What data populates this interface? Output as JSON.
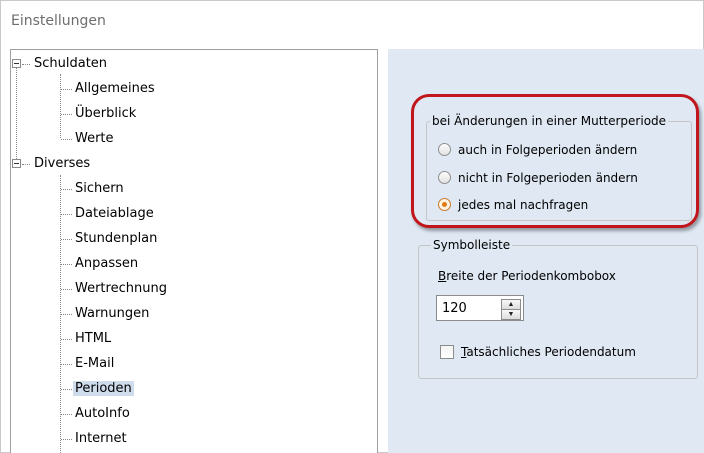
{
  "window": {
    "title": "Einstellungen"
  },
  "tree": {
    "groups": [
      {
        "label": "Schuldaten",
        "expander": "−",
        "items": [
          "Allgemeines",
          "Überblick",
          "Werte"
        ]
      },
      {
        "label": "Diverses",
        "expander": "−",
        "items": [
          "Sichern",
          "Dateiablage",
          "Stundenplan",
          "Anpassen",
          "Wertrechnung",
          "Warnungen",
          "HTML",
          "E-Mail",
          "Perioden",
          "AutoInfo",
          "Internet"
        ]
      }
    ],
    "selected": "Perioden"
  },
  "changes_group": {
    "caption": "bei Änderungen in einer Mutterperiode",
    "options": [
      {
        "label": "auch in Folgeperioden ändern",
        "checked": false
      },
      {
        "label": "nicht in Folgeperioden ändern",
        "checked": false
      },
      {
        "label": "jedes mal nachfragen",
        "checked": true
      }
    ]
  },
  "toolbar_group": {
    "caption": "Symbolleiste",
    "width_label": "Breite der Periodenkombobox",
    "width_label_accel": "B",
    "width_label_rest": "reite der Periodenkombobox",
    "width_value": "120",
    "spin_up": "▲",
    "spin_down": "▼",
    "checkbox_label_accel": "T",
    "checkbox_label_rest": "atsächliches Periodendatum",
    "checkbox_checked": false
  },
  "colors": {
    "panel_bg": "#dfe8f3",
    "highlight": "#c0161c",
    "selected_item_bg": "#cfdcec",
    "radio_checked": "#e07a10"
  }
}
